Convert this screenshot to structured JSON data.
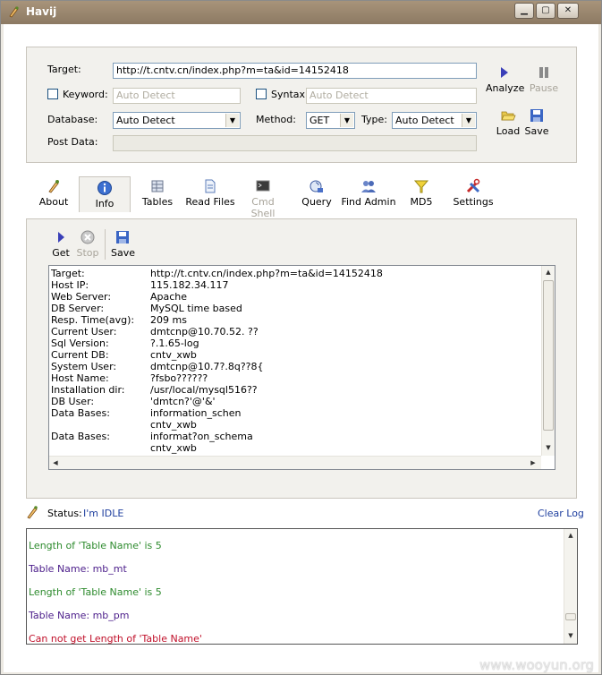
{
  "window": {
    "title": "Havij"
  },
  "target": {
    "label": "Target:",
    "value": "http://t.cntv.cn/index.php?m=ta&id=14152418",
    "keyword_label": "Keyword:",
    "keyword_placeholder": "Auto Detect",
    "syntax_label": "Syntax:",
    "syntax_placeholder": "Auto Detect",
    "database_label": "Database:",
    "database_value": "Auto Detect",
    "method_label": "Method:",
    "method_value": "GET",
    "type_label": "Type:",
    "type_value": "Auto Detect",
    "postdata_label": "Post Data:"
  },
  "actions": {
    "analyze": "Analyze",
    "pause": "Pause",
    "load": "Load",
    "save": "Save"
  },
  "tabs": [
    {
      "label": "About",
      "icon": "about-icon"
    },
    {
      "label": "Info",
      "icon": "info-icon"
    },
    {
      "label": "Tables",
      "icon": "tables-icon"
    },
    {
      "label": "Read Files",
      "icon": "read-files-icon"
    },
    {
      "label": "Cmd Shell",
      "icon": "cmd-shell-icon"
    },
    {
      "label": "Query",
      "icon": "query-icon"
    },
    {
      "label": "Find Admin",
      "icon": "find-admin-icon"
    },
    {
      "label": "MD5",
      "icon": "md5-icon"
    },
    {
      "label": "Settings",
      "icon": "settings-icon"
    }
  ],
  "info_toolbar": {
    "get": "Get",
    "stop": "Stop",
    "save": "Save"
  },
  "info": {
    "rows": [
      {
        "k": "Target:",
        "v": "http://t.cntv.cn/index.php?m=ta&id=14152418"
      },
      {
        "k": "Host IP:",
        "v": "115.182.34.117"
      },
      {
        "k": "Web Server:",
        "v": "Apache"
      },
      {
        "k": "DB Server:",
        "v": "MySQL time based"
      },
      {
        "k": "Resp. Time(avg):",
        "v": "209 ms"
      },
      {
        "k": "Current User:",
        "v": "dmtcnp@10.70.52. ??"
      },
      {
        "k": "Sql Version:",
        "v": "?.1.65-log"
      },
      {
        "k": "Current DB:",
        "v": "cntv_xwb"
      },
      {
        "k": "System User:",
        "v": "dmtcnp@10.7?.8q??8{"
      },
      {
        "k": "Host Name:",
        "v": "?fsbo??????"
      },
      {
        "k": "Installation dir:",
        "v": "/usr/local/mysql516??"
      },
      {
        "k": "DB User:",
        "v": "'dmtcn?'@'&'"
      },
      {
        "k": "Data Bases:",
        "v": "information_schen"
      },
      {
        "k": "",
        "v": "cntv_xwb"
      },
      {
        "k": "Data Bases:",
        "v": "informat?on_schema"
      },
      {
        "k": "",
        "v": "cntv_xwb"
      }
    ]
  },
  "status": {
    "label": "Status:",
    "value": "I'm IDLE",
    "clear_log": "Clear Log"
  },
  "log": [
    {
      "text": "Length of 'Table Name' is 5",
      "color": "green"
    },
    {
      "text": "Table Name: mb_mt",
      "color": "purple"
    },
    {
      "text": "Length of 'Table Name' is 5",
      "color": "green"
    },
    {
      "text": "Table Name: mb_pm",
      "color": "purple"
    },
    {
      "text": "Can not get Length of 'Table Name'",
      "color": "red"
    }
  ],
  "watermark": "www.wooyun.org",
  "colors": {
    "green": "#2e8b2e",
    "purple": "#4b1d8a",
    "red": "#c0102a",
    "link": "#1f3f9f"
  }
}
